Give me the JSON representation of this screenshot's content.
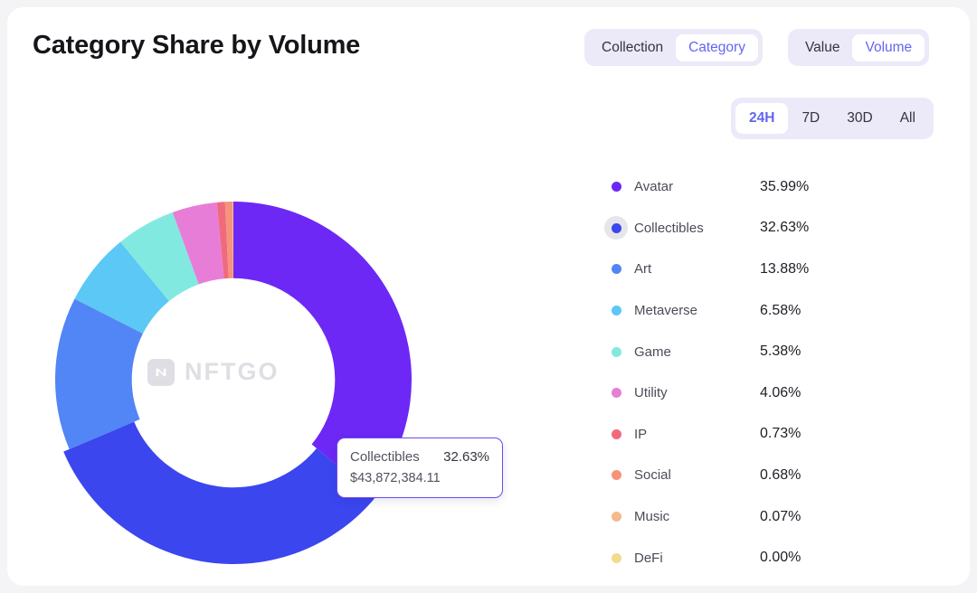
{
  "header": {
    "title": "Category Share by Volume"
  },
  "controls": {
    "scope": {
      "options": [
        "Collection",
        "Category"
      ],
      "selected": "Category"
    },
    "metric": {
      "options": [
        "Value",
        "Volume"
      ],
      "selected": "Volume"
    },
    "range": {
      "options": [
        "24H",
        "7D",
        "30D",
        "All"
      ],
      "selected": "24H"
    }
  },
  "logo": {
    "mark": "nftgo-logo-icon",
    "wordmark": "NFTGO"
  },
  "tooltip": {
    "name": "Collectibles",
    "percent": "32.63%",
    "value": "$43,872,384.11"
  },
  "chart_data": {
    "type": "pie",
    "title": "Category Share by Volume",
    "subtitle": "",
    "xlabel": "",
    "ylabel": "",
    "legend_position": "right",
    "donut": true,
    "hole_ratio": 0.57,
    "start_angle_deg": 0,
    "highlighted_slice": "Collectibles",
    "categories": [
      "Avatar",
      "Collectibles",
      "Art",
      "Metaverse",
      "Game",
      "Utility",
      "IP",
      "Social",
      "Music",
      "DeFi"
    ],
    "values": [
      35.99,
      32.63,
      13.88,
      6.58,
      5.38,
      4.06,
      0.73,
      0.68,
      0.07,
      0.0
    ],
    "labels": [
      "35.99%",
      "32.63%",
      "13.88%",
      "6.58%",
      "5.38%",
      "4.06%",
      "0.73%",
      "0.68%",
      "0.07%",
      "0.00%"
    ],
    "colors": [
      "#6d28f5",
      "#3b46ef",
      "#5285f5",
      "#5bc8f5",
      "#82e9e0",
      "#e87dd8",
      "#f06a7e",
      "#f5937b",
      "#f5b98d",
      "#f5d98d"
    ],
    "slices": [
      {
        "name": "Avatar",
        "value": 35.99,
        "label": "35.99%",
        "color": "#6d28f5"
      },
      {
        "name": "Collectibles",
        "value": 32.63,
        "label": "32.63%",
        "color": "#3b46ef"
      },
      {
        "name": "Art",
        "value": 13.88,
        "label": "13.88%",
        "color": "#5285f5"
      },
      {
        "name": "Metaverse",
        "value": 6.58,
        "label": "6.58%",
        "color": "#5bc8f5"
      },
      {
        "name": "Game",
        "value": 5.38,
        "label": "5.38%",
        "color": "#82e9e0"
      },
      {
        "name": "Utility",
        "value": 4.06,
        "label": "4.06%",
        "color": "#e87dd8"
      },
      {
        "name": "IP",
        "value": 0.73,
        "label": "0.73%",
        "color": "#f06a7e"
      },
      {
        "name": "Social",
        "value": 0.68,
        "label": "0.68%",
        "color": "#f5937b"
      },
      {
        "name": "Music",
        "value": 0.07,
        "label": "0.07%",
        "color": "#f5b98d"
      },
      {
        "name": "DeFi",
        "value": 0.0,
        "label": "0.00%",
        "color": "#f5d98d"
      }
    ]
  }
}
